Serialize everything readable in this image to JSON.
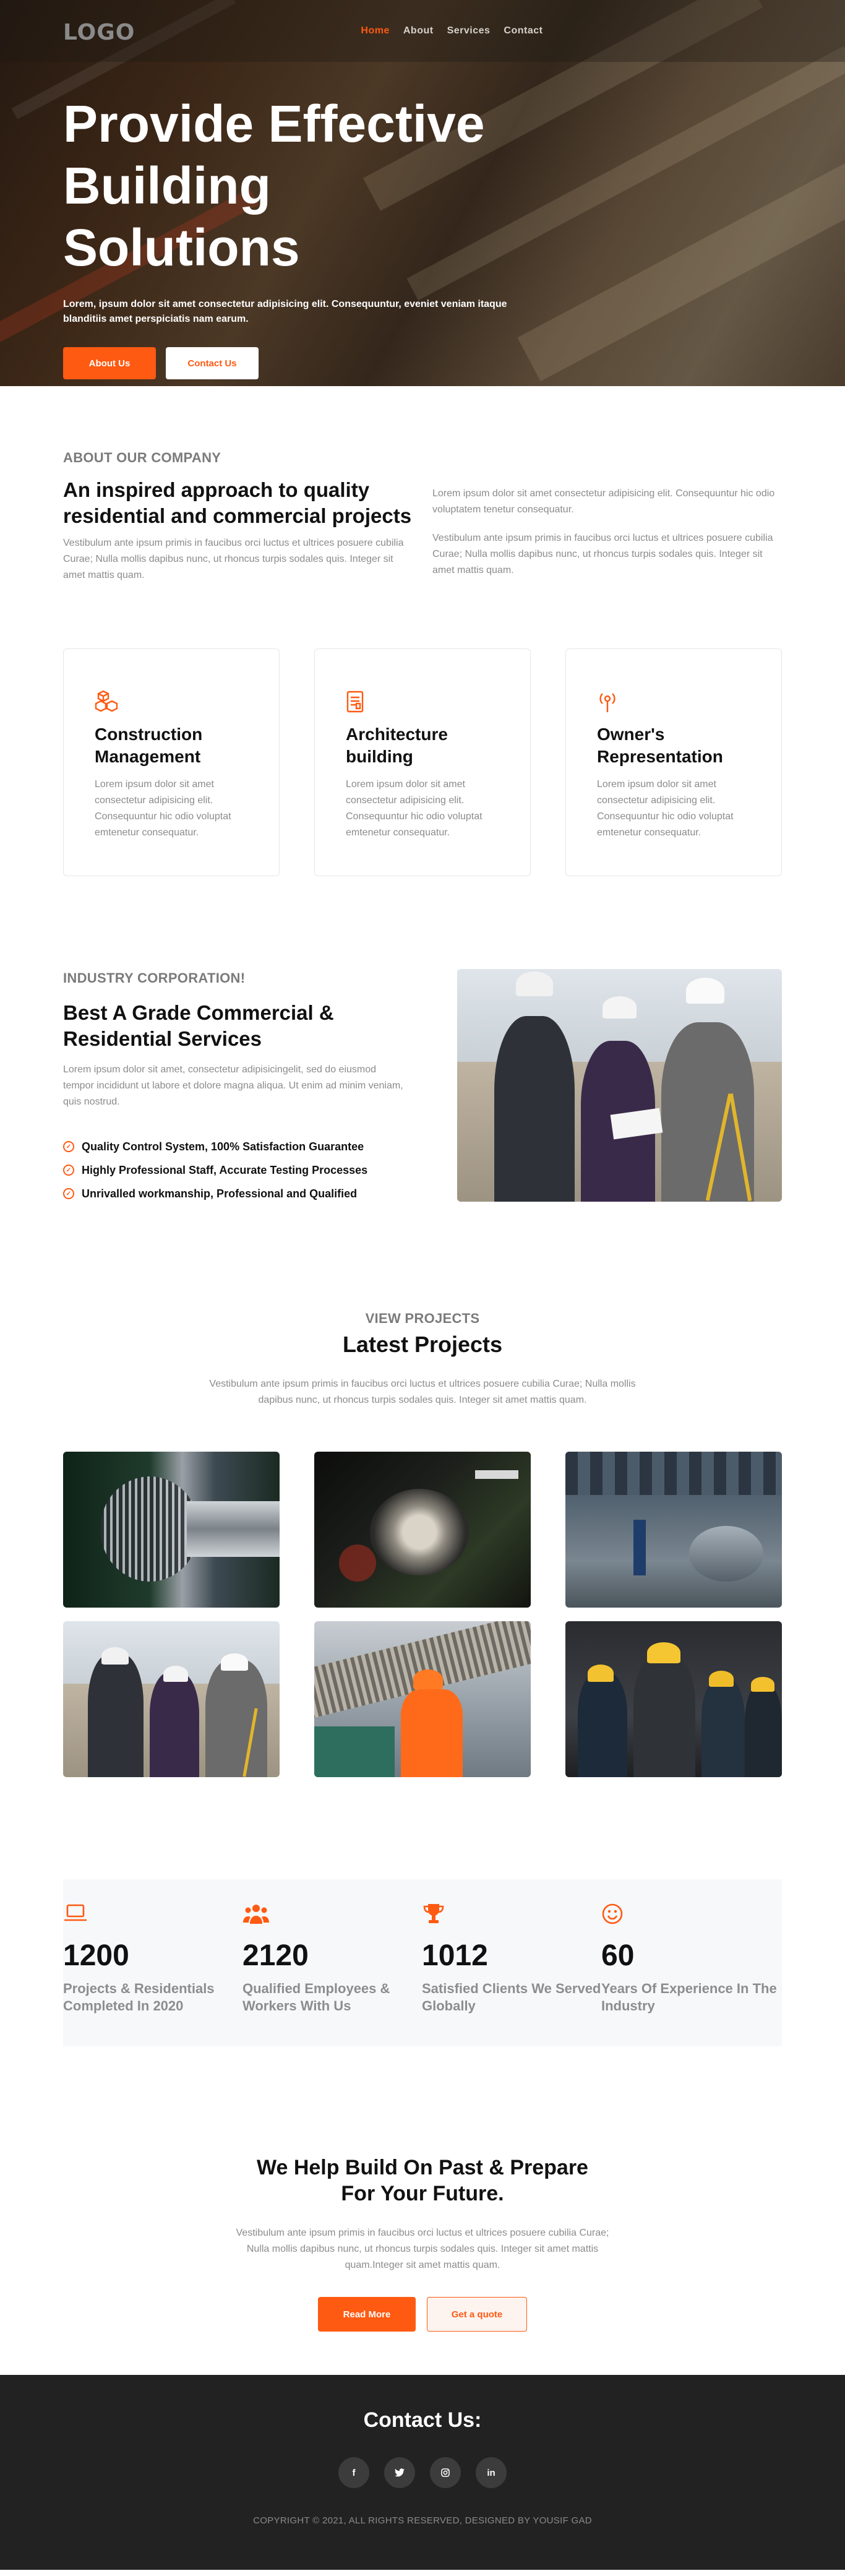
{
  "nav": {
    "logo": "LOGO",
    "items": [
      "Home",
      "About",
      "Services",
      "Contact"
    ]
  },
  "hero": {
    "title": "Provide Effective Building Solutions",
    "text": "Lorem, ipsum dolor sit amet consectetur adipisicing elit. Consequuntur, eveniet veniam itaque blanditiis amet perspiciatis nam earum.",
    "btn_primary": "About Us",
    "btn_secondary": "Contact Us"
  },
  "about": {
    "label": "ABOUT OUR COMPANY",
    "title": "An inspired approach to quality residential and commercial projects",
    "text_left": "Vestibulum ante ipsum primis in faucibus orci luctus et ultrices posuere cubilia Curae; Nulla mollis dapibus nunc, ut rhoncus turpis sodales quis. Integer sit amet mattis quam.",
    "text_right_1": "Lorem ipsum dolor sit amet consectetur adipisicing elit. Consequuntur hic odio voluptatem tenetur consequatur.",
    "text_right_2": "Vestibulum ante ipsum primis in faucibus orci luctus et ultrices posuere cubilia Curae; Nulla mollis dapibus nunc, ut rhoncus turpis sodales quis. Integer sit amet mattis quam."
  },
  "services": [
    {
      "icon": "cubes-icon",
      "title": "Construction Management",
      "text": "Lorem ipsum dolor sit amet consectetur adipisicing elit. Consequuntur hic odio voluptat emtenetur consequatur."
    },
    {
      "icon": "blueprint-icon",
      "title": "Architecture building",
      "text": "Lorem ipsum dolor sit amet consectetur adipisicing elit. Consequuntur hic odio voluptat emtenetur consequatur."
    },
    {
      "icon": "signal-icon",
      "title": "Owner's Representation",
      "text": "Lorem ipsum dolor sit amet consectetur adipisicing elit. Consequuntur hic odio voluptat emtenetur consequatur."
    }
  ],
  "industry": {
    "label": "INDUSTRY CORPORATION!",
    "title": "Best A Grade Commercial & Residential Services",
    "text": "Lorem ipsum dolor sit amet, consectetur adipisicingelit, sed do eiusmod tempor incididunt ut labore et dolore magna aliqua. Ut enim ad minim veniam, quis nostrud.",
    "checks": [
      "Quality Control System, 100% Satisfaction Guarantee",
      "Highly Professional Staff, Accurate Testing Processes",
      "Unrivalled workmanship, Professional and Qualified"
    ]
  },
  "projects": {
    "label": "VIEW PROJECTS",
    "title": "Latest Projects",
    "text": "Vestibulum ante ipsum primis in faucibus orci luctus et ultrices posuere cubilia Curae; Nulla mollis dapibus nunc, ut rhoncus turpis sodales quis. Integer sit amet mattis quam."
  },
  "stats": [
    {
      "icon": "laptop-icon",
      "number": "1200",
      "text": "Projects & Residentials Completed In 2020"
    },
    {
      "icon": "users-icon",
      "number": "2120",
      "text": "Qualified Employees & Workers With Us"
    },
    {
      "icon": "trophy-icon",
      "number": "1012",
      "text": "Satisfied Clients We Served Globally"
    },
    {
      "icon": "smile-icon",
      "number": "60",
      "text": "Years Of Experience In The Industry"
    }
  ],
  "cta": {
    "title": "We Help Build On Past & Prepare For Your Future.",
    "text": "Vestibulum ante ipsum primis in faucibus orci luctus et ultrices posuere cubilia Curae; Nulla mollis dapibus nunc, ut rhoncus turpis sodales quis. Integer sit amet mattis quam.Integer sit amet mattis quam.",
    "btn_primary": "Read More",
    "btn_secondary": "Get a quote"
  },
  "footer": {
    "title": "Contact Us:",
    "socials": [
      "f",
      "t",
      "ig",
      "in"
    ],
    "copyright": "COPYRIGHT © 2021, ALL RIGHTS RESERVED, DESIGNED BY YOUSIF GAD"
  },
  "colors": {
    "accent": "#ff5a12",
    "footer_bg": "#222222",
    "stats_bg": "#f7f8fa"
  }
}
